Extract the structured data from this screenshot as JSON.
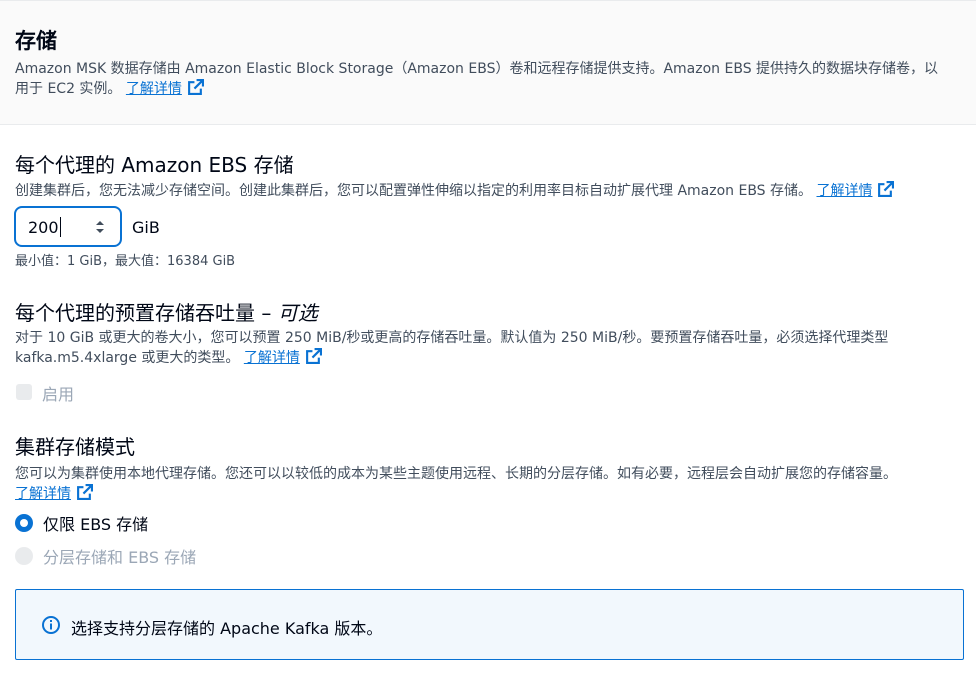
{
  "header": {
    "title": "存储",
    "desc_line1": "Amazon MSK 数据存储由 Amazon Elastic Block Storage（Amazon EBS）卷和远程存储提供支持。Amazon EBS 提供持久的数据块存储卷，以",
    "desc_line2": "用于 EC2 实例。",
    "link": "了解详情"
  },
  "ebs": {
    "title": "每个代理的 Amazon EBS 存储",
    "desc": "创建集群后，您无法减少存储空间。创建此集群后，您可以配置弹性伸缩以指定的利用率目标自动扩展代理 Amazon EBS 存储。",
    "link": "了解详情",
    "value": "200",
    "unit": "GiB",
    "constraint": "最小值：1 GiB，最大值：16384 GiB"
  },
  "throughput": {
    "title": "每个代理的预置存储吞吐量",
    "title_sep": " – ",
    "optional": "可选",
    "desc_line1": "对于 10 GiB 或更大的卷大小，您可以预置 250 MiB/秒或更高的存储吞吐量。默认值为 250 MiB/秒。要预置存储吞吐量，必须选择代理类型",
    "desc_line2": "kafka.m5.4xlarge 或更大的类型。",
    "link": "了解详情",
    "checkbox_label": "启用"
  },
  "mode": {
    "title": "集群存储模式",
    "desc": "您可以为集群使用本地代理存储。您还可以以较低的成本为某些主题使用远程、长期的分层存储。如有必要，远程层会自动扩展您的存储容量。",
    "link": "了解详情",
    "option1": "仅限 EBS 存储",
    "option2": "分层存储和 EBS 存储",
    "selected": "仅限 EBS 存储"
  },
  "alert": {
    "text": "选择支持分层存储的 Apache Kafka 版本。",
    "icon": "info-icon"
  },
  "colors": {
    "accent": "#0972d3",
    "disabled": "#9ba7b6"
  }
}
